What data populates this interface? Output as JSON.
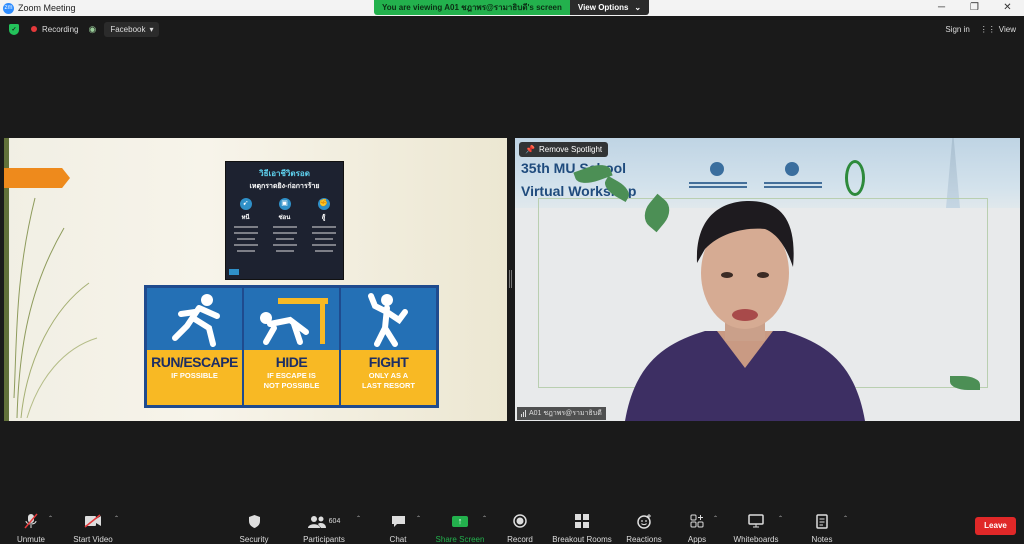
{
  "window": {
    "title": "Zoom Meeting",
    "minimize": "─",
    "maximize": "❐",
    "close": "✕"
  },
  "view_banner": {
    "message": "You are viewing A01 ชฎาพร@รามาธิบดี's screen",
    "options_label": "View Options",
    "options_caret": "⌄"
  },
  "top_bar": {
    "recording_label": "Recording",
    "stream_label": "Facebook",
    "sign_in_label": "Sign in",
    "view_label": "View"
  },
  "shared_screen": {
    "poster": {
      "title": "วิธีเอาชีวิตรอด",
      "subtitle": "เหตุกราดยิง-ก่อการร้าย",
      "cols": [
        "หนี",
        "ซ่อน",
        "สู้"
      ]
    },
    "signs": [
      {
        "title": "RUN/ESCAPE",
        "line1": "IF POSSIBLE",
        "line2": ""
      },
      {
        "title": "HIDE",
        "line1": "IF ESCAPE IS",
        "line2": "NOT POSSIBLE"
      },
      {
        "title": "FIGHT",
        "line1": "ONLY AS A",
        "line2": "LAST RESORT"
      }
    ]
  },
  "video": {
    "spotlight_label": "Remove Spotlight",
    "name_tag": "A01 ชฎาพร@รามาธิบดี",
    "banner": {
      "line1": "35th MU School",
      "line2": "Virtual Workshop"
    }
  },
  "toolbar": {
    "unmute": "Unmute",
    "start_video": "Start Video",
    "security": "Security",
    "participants": "Participants",
    "participants_count": "604",
    "chat": "Chat",
    "share_screen": "Share Screen",
    "record": "Record",
    "breakout_rooms": "Breakout Rooms",
    "reactions": "Reactions",
    "apps": "Apps",
    "whiteboards": "Whiteboards",
    "notes": "Notes",
    "leave": "Leave"
  },
  "colors": {
    "share_green": "#23b14d",
    "leave_red": "#e02828",
    "record_red": "#e5393b",
    "sign_blue": "#2470b5",
    "sign_yellow": "#f8b924"
  }
}
